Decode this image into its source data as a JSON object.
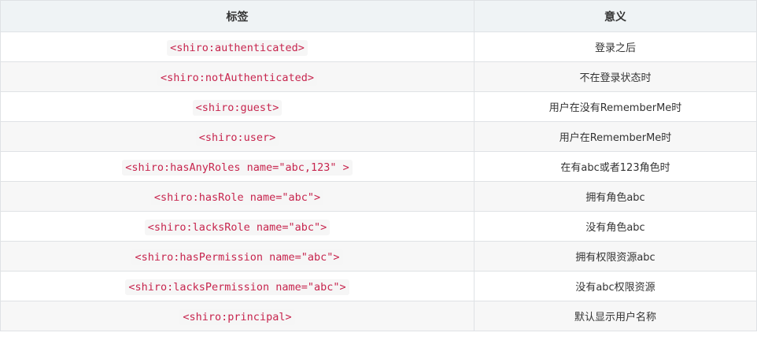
{
  "table": {
    "headers": {
      "tag": "标签",
      "meaning": "意义"
    },
    "rows": [
      {
        "tag": "<shiro:authenticated>",
        "meaning": "登录之后"
      },
      {
        "tag": "<shiro:notAuthenticated>",
        "meaning": "不在登录状态时"
      },
      {
        "tag": "<shiro:guest>",
        "meaning": "用户在没有RememberMe时"
      },
      {
        "tag": "<shiro:user>",
        "meaning": "用户在RememberMe时"
      },
      {
        "tag": "<shiro:hasAnyRoles name=\"abc,123\" >",
        "meaning": "在有abc或者123角色时"
      },
      {
        "tag": "<shiro:hasRole name=\"abc\">",
        "meaning": "拥有角色abc"
      },
      {
        "tag": "<shiro:lacksRole name=\"abc\">",
        "meaning": "没有角色abc"
      },
      {
        "tag": "<shiro:hasPermission name=\"abc\">",
        "meaning": "拥有权限资源abc"
      },
      {
        "tag": "<shiro:lacksPermission name=\"abc\">",
        "meaning": "没有abc权限资源"
      },
      {
        "tag": "<shiro:principal>",
        "meaning": "默认显示用户名称"
      }
    ]
  }
}
